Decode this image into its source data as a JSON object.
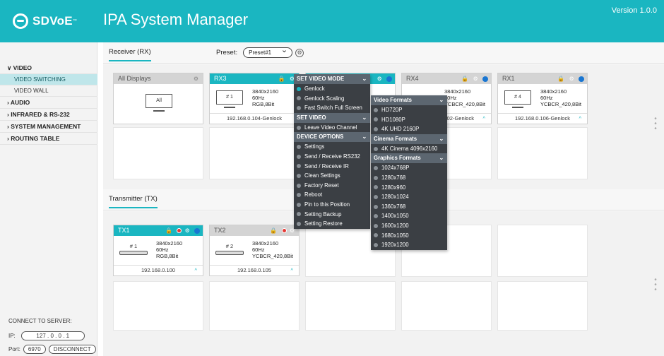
{
  "header": {
    "logo_text": "SDVoE",
    "logo_tm": "™",
    "app_title": "IPA System Manager",
    "version": "Version 1.0.0"
  },
  "sidebar": {
    "items": [
      {
        "label": "∨ VIDEO"
      },
      {
        "label": "VIDEO SWITCHING"
      },
      {
        "label": "VIDEO WALL"
      },
      {
        "label": "› AUDIO"
      },
      {
        "label": "› INFRARED & RS-232"
      },
      {
        "label": "› SYSTEM MANAGEMENT"
      },
      {
        "label": "› ROUTING TABLE"
      }
    ],
    "connect": {
      "title": "CONNECT TO SERVER:",
      "ip_label": "IP:",
      "ip_value": "127 . 0 . 0 . 1",
      "port_label": "Port:",
      "port_value": "6970",
      "disconnect_label": "DISCONNECT"
    }
  },
  "receivers": {
    "tab": "Receiver (RX)",
    "preset_label": "Preset:",
    "preset_value": "Preset#1",
    "all_displays": {
      "title": "All Displays",
      "monitor_label": "All"
    },
    "cards": [
      {
        "name": "RX3",
        "num": "# 1",
        "spec1": "3840x2160",
        "spec2": "60Hz",
        "spec3": "RGB,8Bit",
        "footer": "192.168.0.104-Genlock"
      },
      {
        "name": "RX4",
        "spec1": "3840x2160",
        "spec2": "60Hz",
        "spec3": "YCBCR_420,8Bit",
        "footer": "192.168.0.102-Genlock"
      },
      {
        "name": "RX1",
        "num": "# 4",
        "spec1": "3840x2160",
        "spec2": "60Hz",
        "spec3": "YCBCR_420,8Bit",
        "footer": "192.168.0.106-Genlock"
      }
    ]
  },
  "transmitters": {
    "tab": "Transmitter (TX)",
    "cards": [
      {
        "name": "TX1",
        "num": "# 1",
        "spec1": "3840x2160",
        "spec2": "60Hz",
        "spec3": "RGB,8Bit",
        "footer": "192.168.0.100"
      },
      {
        "name": "TX2",
        "num": "# 2",
        "spec1": "3840x2160",
        "spec2": "60Hz",
        "spec3": "YCBCR_420,8Bit",
        "footer": "192.168.0.105"
      }
    ]
  },
  "menu": {
    "set_video_mode": "SET VIDEO MODE",
    "genlock": "Genlock",
    "genlock_scaling": "Genlock Scaling",
    "fast_switch": "Fast Switch Full Screen",
    "set_video": "SET VIDEO",
    "leave_channel": "Leave Video Channel",
    "device_options": "DEVICE OPTIONS",
    "settings": "Settings",
    "send_rs232": "Send / Receive RS232",
    "send_ir": "Send / Receive IR",
    "clean_settings": "Clean Settings",
    "factory_reset": "Factory Reset",
    "reboot": "Reboot",
    "pin_position": "Pin to this Position",
    "setting_backup": "Setting Backup",
    "setting_restore": "Setting Restore"
  },
  "submenu": {
    "video_formats": "Video Formats",
    "hd720": "HD720P",
    "hd1080": "HD1080P",
    "uhd": "4K UHD 2160P",
    "cinema_formats": "Cinema Formats",
    "cinema4k": "4K Cinema 4096x2160",
    "graphics_formats": "Graphics Formats",
    "graphics": [
      "1024x768P",
      "1280x768",
      "1280x960",
      "1280x1024",
      "1360x768",
      "1400x1050",
      "1600x1200",
      "1680x1050",
      "1920x1200"
    ]
  },
  "colors": {
    "accent": "#1ab6c1",
    "menu_bg": "#3b3f44",
    "menu_header": "#5c6670",
    "status_blue": "#1976d2",
    "status_red": "#e53935"
  }
}
